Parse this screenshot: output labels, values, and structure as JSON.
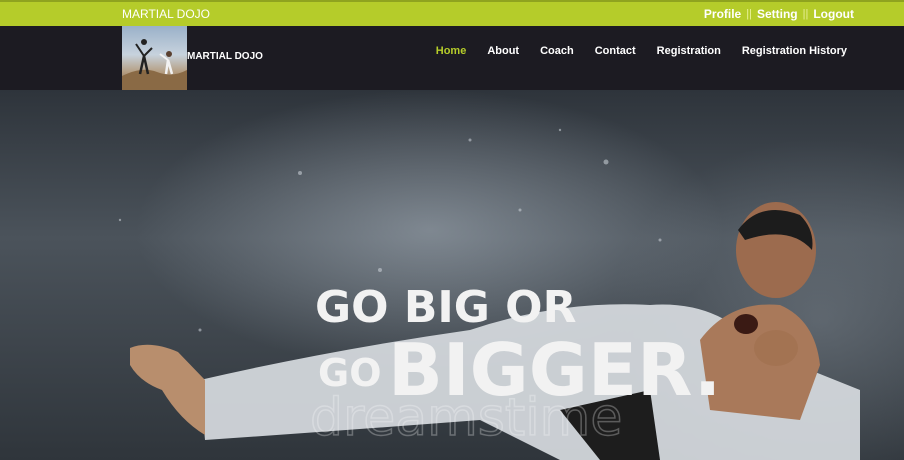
{
  "topbar": {
    "brand": "MARTIAL DOJO",
    "links": {
      "profile": "Profile",
      "setting": "Setting",
      "logout": "Logout"
    },
    "separator": "||"
  },
  "navbar": {
    "logo_text": "MARTIAL DOJO",
    "menu": [
      {
        "label": "Home",
        "active": true
      },
      {
        "label": "About",
        "active": false
      },
      {
        "label": "Coach",
        "active": false
      },
      {
        "label": "Contact",
        "active": false
      },
      {
        "label": "Registration",
        "active": false
      },
      {
        "label": "Registration History",
        "active": false
      }
    ]
  },
  "hero": {
    "line1": "GO BIG OR",
    "line2_small": "GO",
    "line2_big": "BIGGER.",
    "watermark": "dreamstime"
  },
  "colors": {
    "accent": "#b5cc2a",
    "nav_bg": "#1c1b22"
  }
}
